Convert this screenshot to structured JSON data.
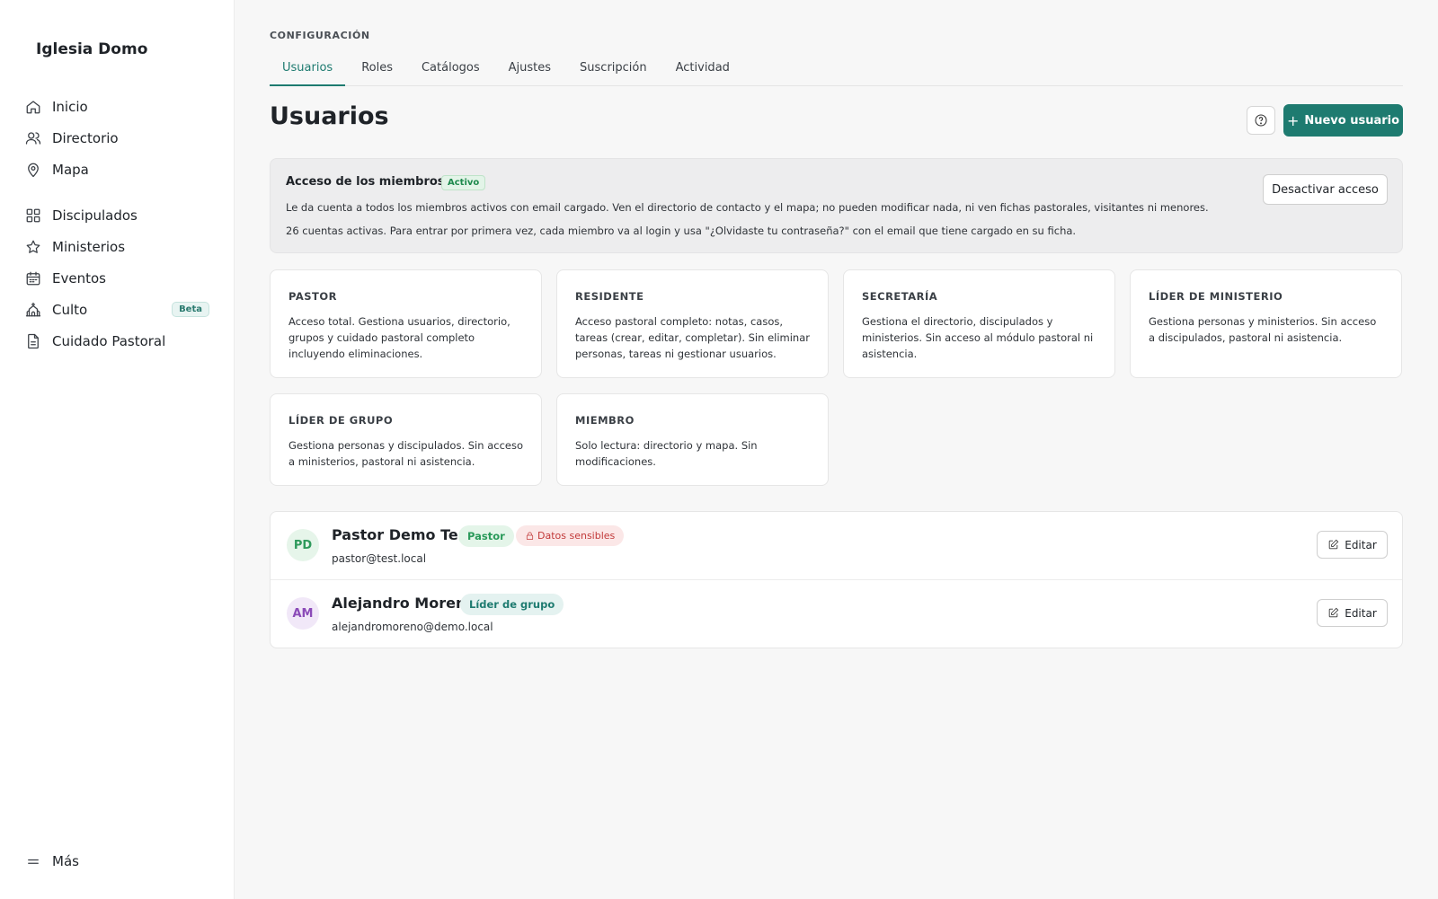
{
  "sidebar": {
    "brand": "Iglesia Domo",
    "items": [
      {
        "label": "Inicio",
        "icon": "home-icon"
      },
      {
        "label": "Directorio",
        "icon": "users-icon"
      },
      {
        "label": "Mapa",
        "icon": "map-pin-icon"
      },
      {
        "label": "Discipulados",
        "icon": "grid-icon"
      },
      {
        "label": "Ministerios",
        "icon": "star-icon"
      },
      {
        "label": "Eventos",
        "icon": "calendar-icon"
      },
      {
        "label": "Culto",
        "icon": "church-icon",
        "badge": "Beta"
      },
      {
        "label": "Cuidado Pastoral",
        "icon": "document-icon"
      }
    ],
    "more": "Más"
  },
  "header": {
    "section": "CONFIGURACIÓN",
    "tabs": [
      "Usuarios",
      "Roles",
      "Catálogos",
      "Ajustes",
      "Suscripción",
      "Actividad"
    ],
    "active_tab": "Usuarios",
    "title": "Usuarios",
    "new_user_label": "Nuevo usuario"
  },
  "access": {
    "title": "Acceso de los miembros",
    "status": "Activo",
    "description": "Le da cuenta a todos los miembros activos con email cargado. Ven el directorio de contacto y el mapa; no pueden modificar nada, ni ven fichas pastorales, visitantes ni menores.",
    "info": "26 cuentas activas. Para entrar por primera vez, cada miembro va al login y usa \"¿Olvidaste tu contraseña?\" con el email que tiene cargado en su ficha.",
    "deactivate_label": "Desactivar acceso"
  },
  "roles": [
    {
      "name": "PASTOR",
      "description": "Acceso total. Gestiona usuarios, directorio, grupos y cuidado pastoral completo incluyendo eliminaciones."
    },
    {
      "name": "RESIDENTE",
      "description": "Acceso pastoral completo: notas, casos, tareas (crear, editar, completar). Sin eliminar personas, tareas ni gestionar usuarios."
    },
    {
      "name": "SECRETARÍA",
      "description": "Gestiona el directorio, discipulados y ministerios. Sin acceso al módulo pastoral ni asistencia."
    },
    {
      "name": "LÍDER DE MINISTERIO",
      "description": "Gestiona personas y ministerios. Sin acceso a discipulados, pastoral ni asistencia."
    },
    {
      "name": "LÍDER DE GRUPO",
      "description": "Gestiona personas y discipulados. Sin acceso a ministerios, pastoral ni asistencia."
    },
    {
      "name": "MIEMBRO",
      "description": "Solo lectura: directorio y mapa. Sin modificaciones."
    }
  ],
  "users": [
    {
      "initials": "PD",
      "name": "Pastor Demo Test",
      "role": "Pastor",
      "sensitive": "Datos sensibles",
      "email": "pastor@test.local",
      "edit_label": "Editar"
    },
    {
      "initials": "AM",
      "name": "Alejandro Moreno",
      "role": "Líder de grupo",
      "email": "alejandromoreno@demo.local",
      "edit_label": "Editar"
    }
  ],
  "colors": {
    "accent": "#1e7b70",
    "active_badge": "#1e8a4d",
    "sensitive": "#c23a3a"
  }
}
